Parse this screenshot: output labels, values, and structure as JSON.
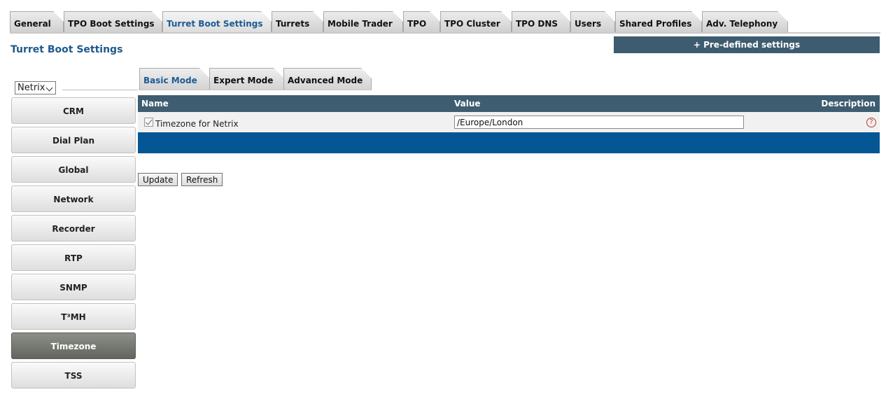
{
  "top_tabs": [
    {
      "label": "General"
    },
    {
      "label": "TPO Boot Settings"
    },
    {
      "label": "Turret Boot Settings",
      "active": true
    },
    {
      "label": "Turrets"
    },
    {
      "label": "Mobile Trader"
    },
    {
      "label": "TPO"
    },
    {
      "label": "TPO Cluster"
    },
    {
      "label": "TPO DNS"
    },
    {
      "label": "Users"
    },
    {
      "label": "Shared Profiles"
    },
    {
      "label": "Adv. Telephony"
    }
  ],
  "page_title": "Turret Boot Settings",
  "predefined_button": "+ Pre-defined settings",
  "device_select": {
    "value": "Netrix"
  },
  "mode_tabs": [
    {
      "label": "Basic Mode",
      "active": true
    },
    {
      "label": "Expert Mode"
    },
    {
      "label": "Advanced Mode"
    }
  ],
  "sidebar": {
    "items": [
      {
        "label": "CRM"
      },
      {
        "label": "Dial Plan"
      },
      {
        "label": "Global"
      },
      {
        "label": "Network"
      },
      {
        "label": "Recorder"
      },
      {
        "label": "RTP"
      },
      {
        "label": "SNMP"
      },
      {
        "label": "T³MH"
      },
      {
        "label": "Timezone",
        "active": true
      },
      {
        "label": "TSS"
      }
    ]
  },
  "table": {
    "headers": {
      "name": "Name",
      "value": "Value",
      "description": "Description"
    },
    "rows": [
      {
        "checked": true,
        "name": "Timezone for Netrix",
        "value": "/Europe/London",
        "help_icon": "question-circle-icon"
      }
    ]
  },
  "actions": {
    "update": "Update",
    "refresh": "Refresh"
  },
  "colors": {
    "header_bar": "#3e5d70",
    "accent_blue": "#045694",
    "title_blue": "#1f5a8b",
    "help_red": "#c0392b"
  }
}
